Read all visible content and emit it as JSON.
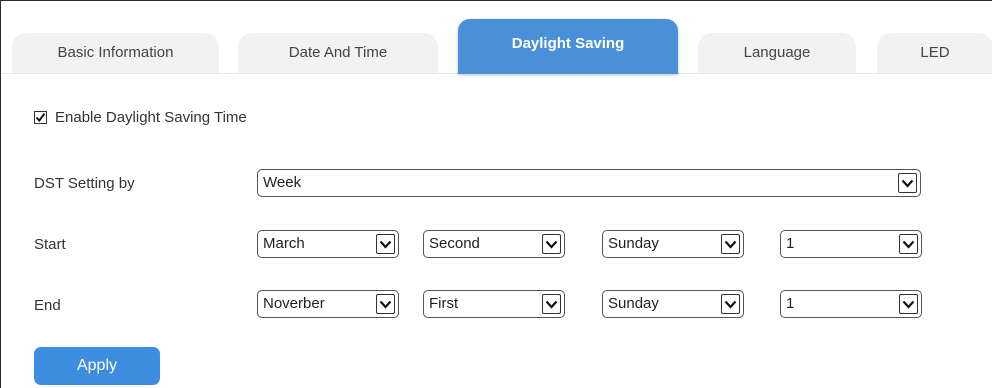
{
  "tabs": [
    {
      "label": "Basic Information",
      "active": false
    },
    {
      "label": "Date And Time",
      "active": false
    },
    {
      "label": "Daylight Saving",
      "active": true
    },
    {
      "label": "Language",
      "active": false
    },
    {
      "label": "LED",
      "active": false
    }
  ],
  "enable_dst": {
    "label": "Enable Daylight Saving Time",
    "checked": true
  },
  "dst_setting": {
    "label": "DST Setting by",
    "value": "Week"
  },
  "start": {
    "label": "Start",
    "month": "March",
    "week": "Second",
    "day": "Sunday",
    "hour": "1"
  },
  "end": {
    "label": "End",
    "month": "Noverber",
    "week": "First",
    "day": "Sunday",
    "hour": "1"
  },
  "apply_label": "Apply",
  "colors": {
    "active_tab": "#4a90d9",
    "inactive_tab": "#f2f2f2",
    "button": "#3d8de0"
  }
}
